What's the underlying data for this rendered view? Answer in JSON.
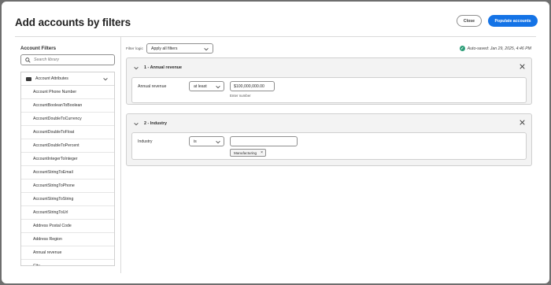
{
  "dialog": {
    "title": "Add accounts by filters",
    "close_label": "Close",
    "populate_label": "Populate accounts"
  },
  "sidebar": {
    "title": "Account Filters",
    "search_placeholder": "Search library",
    "group": "Account Attributes",
    "items": [
      "Account Phone Number",
      "AccountBooleanToBoolean",
      "AccountDoubleToCurrency",
      "AccountDoubleToFloat",
      "AccountDoubleToPercent",
      "AccountIntegerToInteger",
      "AccountStringToEmail",
      "AccountStringToPhone",
      "AccountStringToString",
      "AccountStringToUrl",
      "Address Postal Code",
      "Address Region",
      "Annual revenue",
      "City"
    ]
  },
  "main": {
    "filter_logic_label": "Filter logic",
    "filter_logic_value": "Apply all filters",
    "autosave": "Auto-saved: Jan 29, 2025, 4:46 PM",
    "filters": [
      {
        "heading": "1 - Annual revenue",
        "field": "Annual revenue",
        "operator": "at least",
        "value": "$100,000,000.00",
        "help": "Enter number"
      },
      {
        "heading": "2 - Industry",
        "field": "Industry",
        "operator": "is",
        "value": "",
        "tag": "Manufacturing"
      }
    ]
  },
  "colors": {
    "accent": "#1473e6",
    "success": "#2d9d78"
  }
}
